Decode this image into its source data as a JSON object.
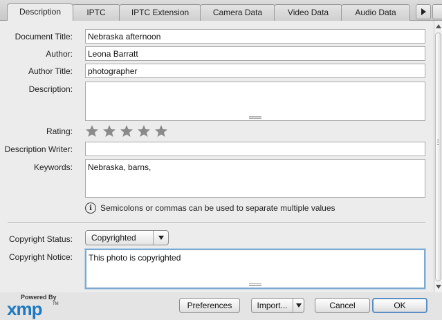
{
  "tabs": [
    {
      "label": "Description",
      "active": true
    },
    {
      "label": "IPTC",
      "active": false
    },
    {
      "label": "IPTC Extension",
      "active": false
    },
    {
      "label": "Camera Data",
      "active": false
    },
    {
      "label": "Video Data",
      "active": false
    },
    {
      "label": "Audio Data",
      "active": false
    }
  ],
  "form": {
    "document_title": {
      "label": "Document Title:",
      "value": "Nebraska afternoon"
    },
    "author": {
      "label": "Author:",
      "value": "Leona Barratt"
    },
    "author_title": {
      "label": "Author Title:",
      "value": "photographer"
    },
    "description": {
      "label": "Description:",
      "value": ""
    },
    "rating": {
      "label": "Rating:",
      "value": 0,
      "max": 5
    },
    "description_writer": {
      "label": "Description Writer:",
      "value": ""
    },
    "keywords": {
      "label": "Keywords:",
      "value": "Nebraska, barns,"
    },
    "hint": "Semicolons or commas can be used to separate multiple values",
    "copyright_status": {
      "label": "Copyright Status:",
      "value": "Copyrighted"
    },
    "copyright_notice": {
      "label": "Copyright Notice:",
      "value": "This photo is copyrighted"
    }
  },
  "icons": {
    "info": "info-icon",
    "star": "star-icon",
    "dropdown": "chevron-down-icon",
    "tab_scroll": "chevron-right-icon"
  },
  "footer": {
    "logo_powered": "Powered By",
    "logo_brand": "xmp",
    "logo_tm": "TM",
    "preferences": "Preferences",
    "import": "Import...",
    "cancel": "Cancel",
    "ok": "OK"
  },
  "colors": {
    "accent": "#5b8fc4",
    "xmp_blue": "#1f78c1",
    "star": "#8a8a8a"
  }
}
